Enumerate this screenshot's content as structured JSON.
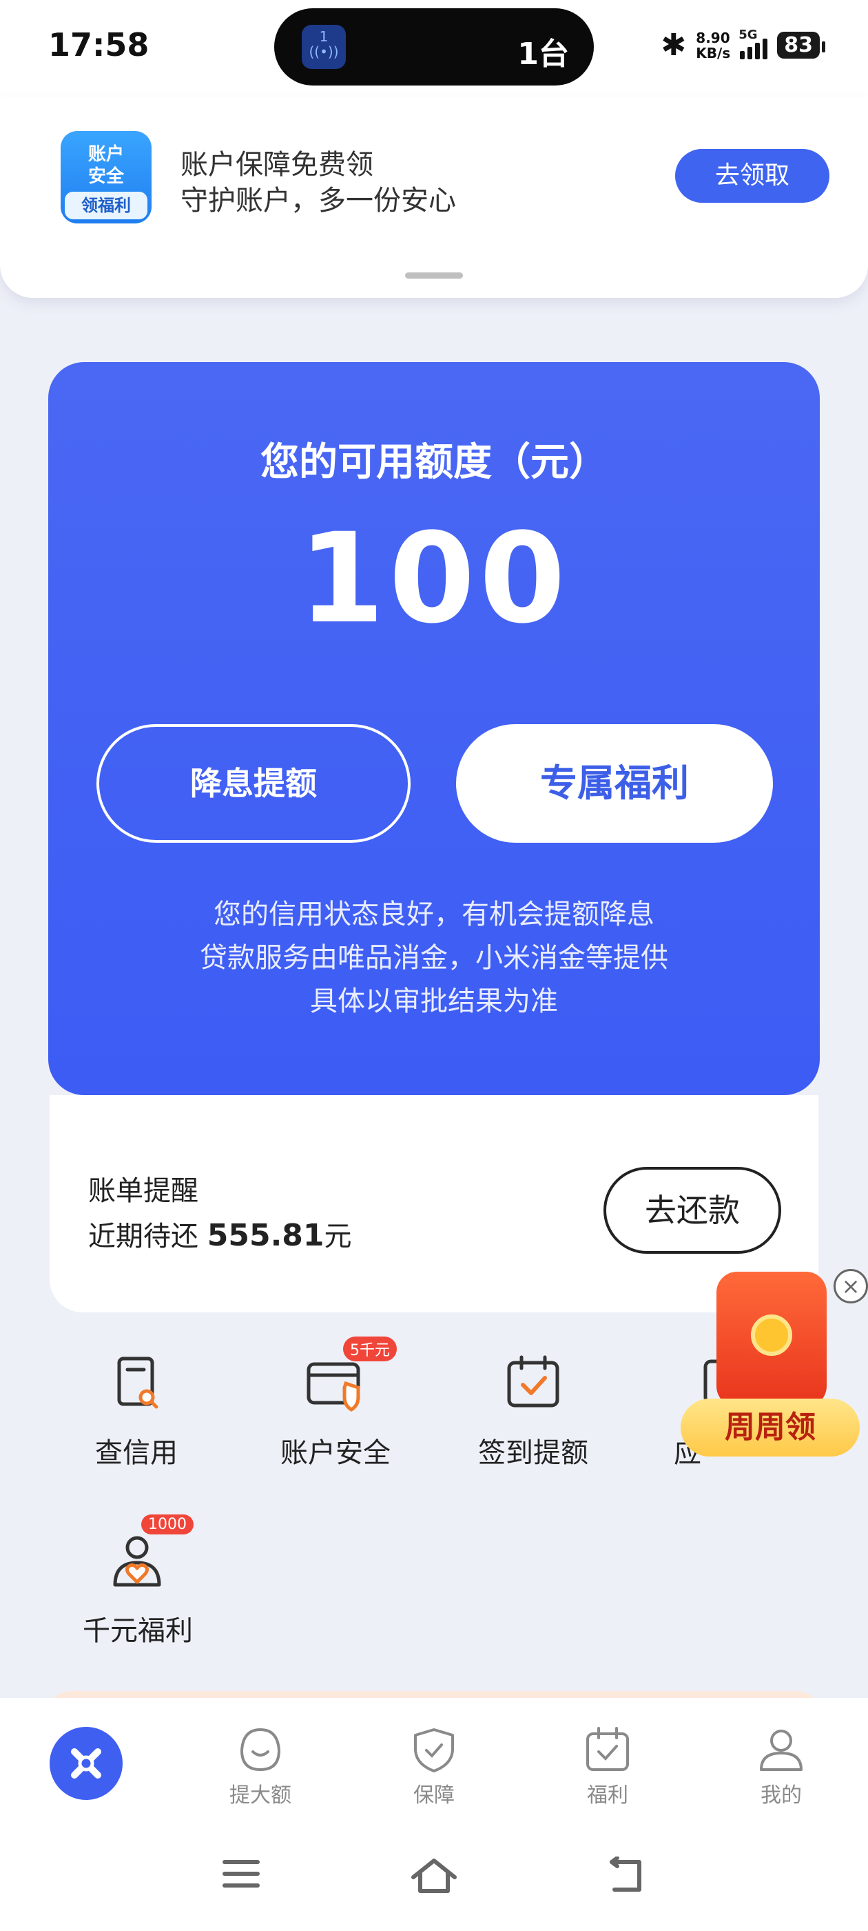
{
  "status_bar": {
    "time": "17:58",
    "island_badge": "1",
    "island_text": "1台",
    "net_speed_top": "8.90",
    "net_speed_bottom": "KB/s",
    "network": "5G",
    "battery": "83"
  },
  "notification": {
    "logo_top": "账户\n安全",
    "logo_bottom": "领福利",
    "title": "账户保障免费领",
    "subtitle": "守护账户，多一份安心",
    "button": "去领取"
  },
  "credit": {
    "title": "您的可用额度（元）",
    "amount": "100",
    "btn_left": "降息提额",
    "btn_right": "专属福利",
    "note_1": "您的信用状态良好，有机会提额降息",
    "note_2": "贷款服务由唯品消金，小米消金等提供",
    "note_3": "具体以审批结果为准"
  },
  "bill": {
    "title": "账单提醒",
    "due_prefix": "近期待还 ",
    "due_amount": "555.81",
    "due_unit": "元",
    "button": "去还款"
  },
  "quick": {
    "items": [
      {
        "label": "查信用",
        "icon": "credit-report-icon"
      },
      {
        "label": "账户安全",
        "icon": "card-shield-icon",
        "badge": "5千元"
      },
      {
        "label": "签到提额",
        "icon": "calendar-check-icon"
      },
      {
        "label": "应",
        "icon": "partial-icon"
      },
      {
        "label": "千元福利",
        "icon": "user-heart-icon",
        "badge": "1000"
      }
    ]
  },
  "promo": {
    "label": "周周领",
    "close": "×"
  },
  "bottom_nav": {
    "items": [
      {
        "label": "",
        "icon": "home-logo-icon"
      },
      {
        "label": "提大额",
        "icon": "smile-icon"
      },
      {
        "label": "保障",
        "icon": "shield-check-icon"
      },
      {
        "label": "福利",
        "icon": "calendar-check-icon"
      },
      {
        "label": "我的",
        "icon": "person-icon"
      }
    ]
  },
  "colors": {
    "primary": "#3f64f0",
    "card": "#4563f3",
    "badge": "#f0463a",
    "icon_accent": "#f07a2a"
  }
}
